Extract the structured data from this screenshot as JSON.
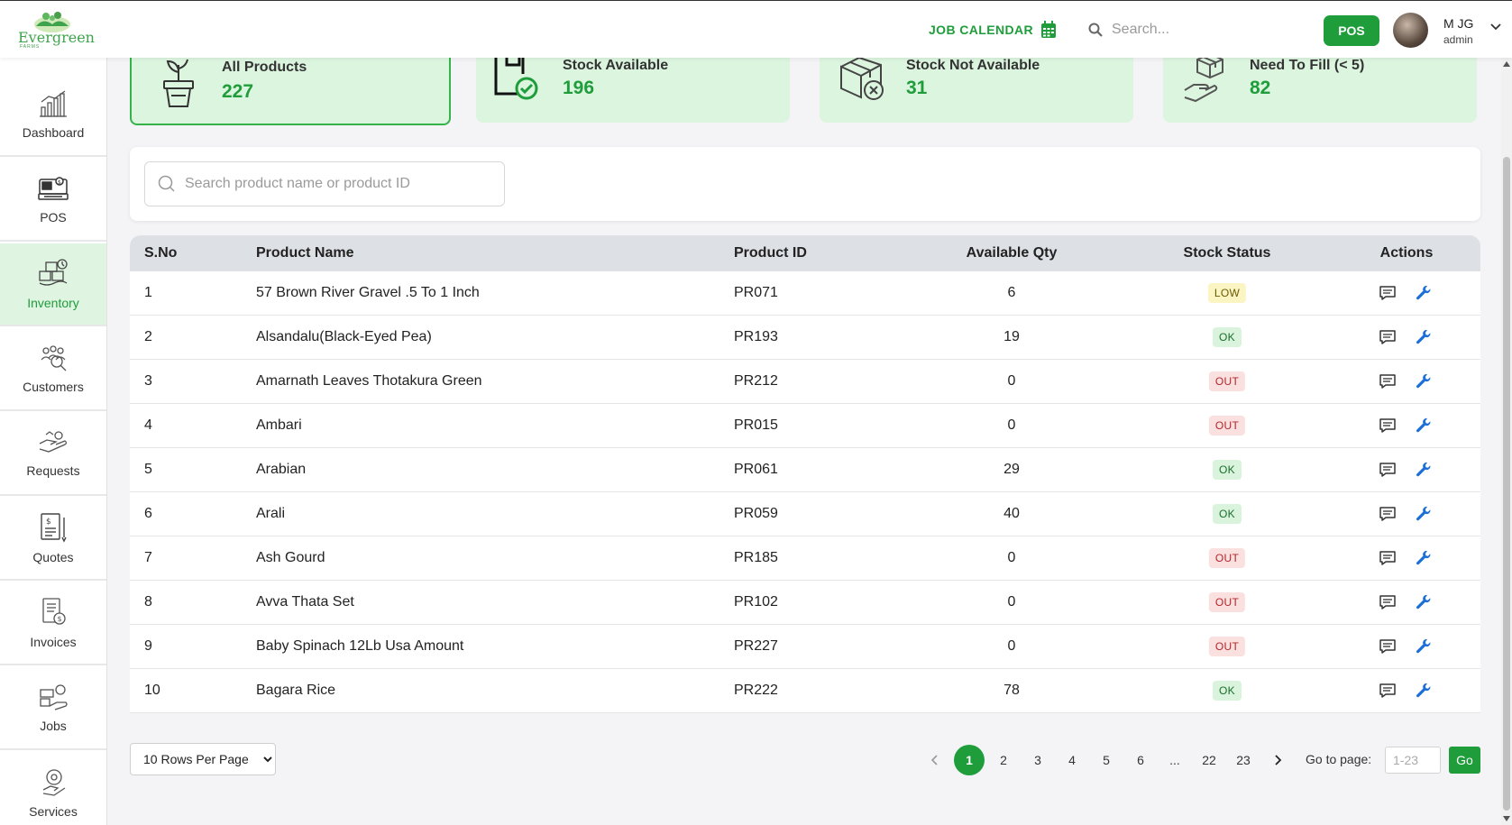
{
  "header": {
    "brand": "Evergreen",
    "brand_sub": "FARMS",
    "job_calendar": "JOB CALENDAR",
    "search_placeholder": "Search...",
    "pos_button": "POS",
    "user_name": "M JG",
    "user_role": "admin"
  },
  "sidebar": {
    "items": [
      {
        "label": "Dashboard",
        "icon": "chart-bars-icon"
      },
      {
        "label": "POS",
        "icon": "pos-terminal-icon"
      },
      {
        "label": "Inventory",
        "icon": "inventory-boxes-icon",
        "active": true
      },
      {
        "label": "Customers",
        "icon": "customers-icon"
      },
      {
        "label": "Requests",
        "icon": "hand-request-icon"
      },
      {
        "label": "Quotes",
        "icon": "quote-document-icon"
      },
      {
        "label": "Invoices",
        "icon": "invoice-icon"
      },
      {
        "label": "Jobs",
        "icon": "jobs-icon"
      },
      {
        "label": "Services",
        "icon": "services-icon"
      }
    ]
  },
  "stats": [
    {
      "title": "All Products",
      "value": "227",
      "icon": "plant-pot-icon"
    },
    {
      "title": "Stock Available",
      "value": "196",
      "icon": "stock-check-icon"
    },
    {
      "title": "Stock Not Available",
      "value": "31",
      "icon": "box-cross-icon"
    },
    {
      "title": "Need To Fill (< 5)",
      "value": "82",
      "icon": "hand-box-icon"
    }
  ],
  "product_search": {
    "placeholder": "Search product name or product ID"
  },
  "table": {
    "headers": [
      "S.No",
      "Product Name",
      "Product ID",
      "Available Qty",
      "Stock Status",
      "Actions"
    ],
    "rows": [
      {
        "sno": "1",
        "name": "57 Brown River Gravel .5 To 1 Inch",
        "id": "PR071",
        "qty": "6",
        "status": "LOW"
      },
      {
        "sno": "2",
        "name": "Alsandalu(Black-Eyed Pea)",
        "id": "PR193",
        "qty": "19",
        "status": "OK"
      },
      {
        "sno": "3",
        "name": "Amarnath Leaves Thotakura Green",
        "id": "PR212",
        "qty": "0",
        "status": "OUT"
      },
      {
        "sno": "4",
        "name": "Ambari",
        "id": "PR015",
        "qty": "0",
        "status": "OUT"
      },
      {
        "sno": "5",
        "name": "Arabian",
        "id": "PR061",
        "qty": "29",
        "status": "OK"
      },
      {
        "sno": "6",
        "name": "Arali",
        "id": "PR059",
        "qty": "40",
        "status": "OK"
      },
      {
        "sno": "7",
        "name": "Ash Gourd",
        "id": "PR185",
        "qty": "0",
        "status": "OUT"
      },
      {
        "sno": "8",
        "name": "Avva Thata Set",
        "id": "PR102",
        "qty": "0",
        "status": "OUT"
      },
      {
        "sno": "9",
        "name": "Baby Spinach 12Lb Usa Amount",
        "id": "PR227",
        "qty": "0",
        "status": "OUT"
      },
      {
        "sno": "10",
        "name": "Bagara Rice",
        "id": "PR222",
        "qty": "78",
        "status": "OK"
      }
    ]
  },
  "footer": {
    "rows_per_page": "10 Rows Per Page",
    "pages": [
      "1",
      "2",
      "3",
      "4",
      "5",
      "6",
      "...",
      "22",
      "23"
    ],
    "current_page": "1",
    "goto_label": "Go to page:",
    "goto_placeholder": "1-23",
    "go_button": "Go"
  },
  "colors": {
    "accent": "#1f9d3a",
    "card_bg": "#dcf5df",
    "header_row": "#dde0e4",
    "low": "#fbf5c4",
    "ok": "#d9f3dd",
    "out": "#fbe0e0",
    "wrench": "#1d6fd8"
  }
}
